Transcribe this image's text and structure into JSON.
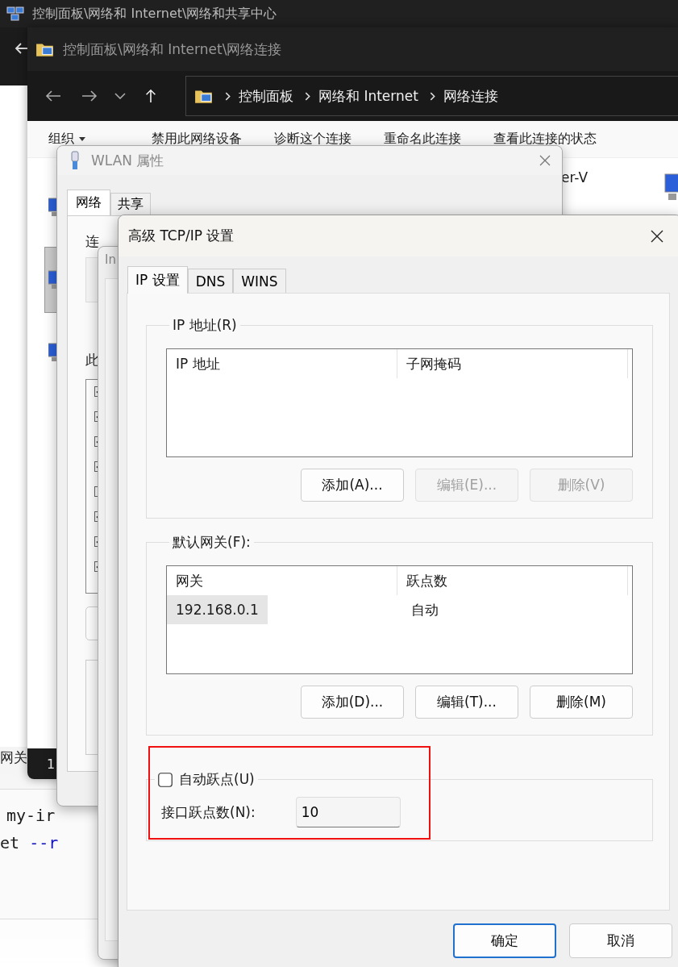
{
  "background_window": {
    "title": "控制面板\\网络和 Internet\\网络和共享中心",
    "gateway_label": "网关",
    "code_lines": [
      [
        {
          "text": "my-ir",
          "kind": "plain"
        }
      ],
      [
        {
          "text": "et ",
          "kind": "plain"
        },
        {
          "text": "--r",
          "kind": "flag"
        }
      ]
    ]
  },
  "network_connections": {
    "title": "控制面板\\网络和 Internet\\网络连接",
    "breadcrumb": [
      "控制面板",
      "网络和 Internet",
      "网络连接"
    ],
    "toolbar": [
      {
        "label": "组织",
        "dropdown": true
      },
      {
        "label": "禁用此网络设备",
        "dropdown": false
      },
      {
        "label": "诊断这个连接",
        "dropdown": false
      },
      {
        "label": "重命名此连接",
        "dropdown": false
      },
      {
        "label": "查看此连接的状态",
        "dropdown": false
      }
    ],
    "adapters": [
      {
        "selected": false
      },
      {
        "selected": true
      },
      {
        "selected": false
      }
    ],
    "adapter_name_fragment": "er-V",
    "status_bar": "1"
  },
  "wlan_properties": {
    "title": "WLAN 属性",
    "tabs": [
      {
        "label": "网络",
        "selected": true
      },
      {
        "label": "共享",
        "selected": false
      }
    ],
    "connect_label_fragment": "连",
    "components_label_fragment": "此",
    "components": [
      {
        "checked": true
      },
      {
        "checked": true
      },
      {
        "checked": true
      },
      {
        "checked": true
      },
      {
        "checked": false
      },
      {
        "checked": true
      },
      {
        "checked": true
      },
      {
        "checked": true
      }
    ]
  },
  "ipv4_properties": {
    "title_fragment": "In"
  },
  "advanced_tcpip": {
    "title": "高级 TCP/IP 设置",
    "tabs": [
      {
        "label": "IP 设置",
        "selected": true
      },
      {
        "label": "DNS",
        "selected": false
      },
      {
        "label": "WINS",
        "selected": false
      }
    ],
    "ip_group": {
      "label": "IP 地址(R)",
      "columns": [
        "IP 地址",
        "子网掩码"
      ],
      "buttons": [
        {
          "label": "添加(A)...",
          "disabled": false
        },
        {
          "label": "编辑(E)...",
          "disabled": true
        },
        {
          "label": "删除(V)",
          "disabled": true
        }
      ]
    },
    "gateway_group": {
      "label": "默认网关(F):",
      "columns": [
        "网关",
        "跃点数"
      ],
      "rows": [
        {
          "cells": [
            "192.168.0.1",
            "自动"
          ],
          "selected": true
        }
      ],
      "buttons": [
        {
          "label": "添加(D)...",
          "disabled": false
        },
        {
          "label": "编辑(T)...",
          "disabled": false
        },
        {
          "label": "删除(M)",
          "disabled": false
        }
      ]
    },
    "metric": {
      "auto_label": "自动跃点(U)",
      "auto_checked": false,
      "metric_label": "接口跃点数(N):",
      "metric_value": "10"
    },
    "buttons": [
      {
        "label": "确定",
        "default": true
      },
      {
        "label": "取消",
        "default": false
      }
    ]
  }
}
